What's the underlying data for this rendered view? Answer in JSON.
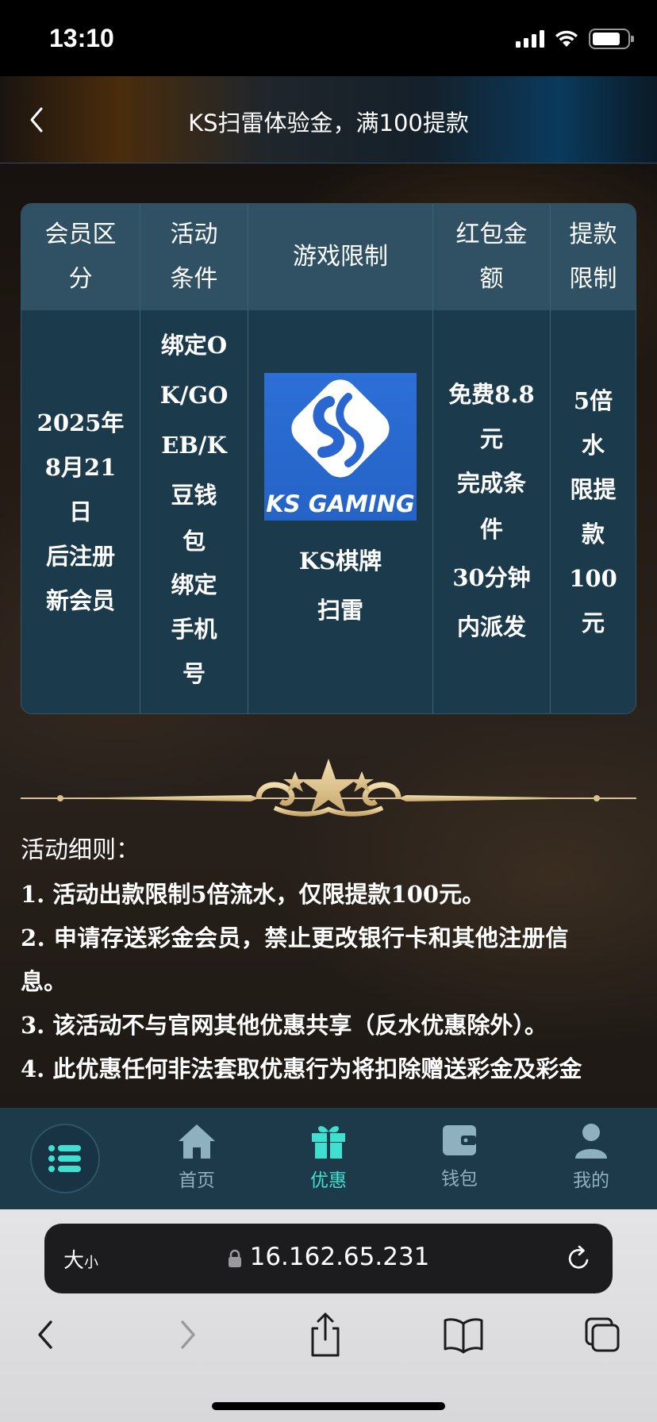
{
  "status_bar": {
    "time": "13:10"
  },
  "header": {
    "title": "KS扫雷体验金，满100提款"
  },
  "table": {
    "headers": [
      [
        "会员区",
        "分"
      ],
      [
        "活动",
        "条件"
      ],
      [
        "游戏限制"
      ],
      [
        "红包金",
        "额"
      ],
      [
        "提款",
        "限制"
      ]
    ],
    "member_lines": [
      "2025年",
      "8月21",
      "日",
      "后注册",
      "新会员"
    ],
    "condition_lines": [
      "绑定O",
      "K/GO",
      "EB/K",
      "豆钱",
      "包",
      "绑定",
      "手机",
      "号"
    ],
    "game_logo_text": "KS GAMING",
    "game_lines": [
      "KS棋牌",
      "扫雷"
    ],
    "bonus_lines": [
      "免费8.8",
      "元",
      "完成条",
      "件",
      "30分钟",
      "内派发"
    ],
    "withdraw_lines": [
      "5倍",
      "水",
      "限提",
      "款",
      "100",
      "元"
    ]
  },
  "rules": {
    "title": "活动细则：",
    "items": [
      "1. 活动出款限制5倍流水，仅限提款100元。",
      "2. 申请存送彩金会员，禁止更改银行卡和其他注册信",
      "息。",
      "3. 该活动不与官网其他优惠共享（反水优惠除外）。",
      "4. 此优惠任何非法套取优惠行为将扣除赠送彩金及彩金"
    ]
  },
  "tabbar": {
    "home": "首页",
    "promo": "优惠",
    "wallet": "钱包",
    "mine": "我的",
    "active_color": "#3fe0d0",
    "inactive_color": "#8fb0bf"
  },
  "browser": {
    "text_size_big": "大",
    "text_size_small": "小",
    "url": "16.162.65.231"
  }
}
